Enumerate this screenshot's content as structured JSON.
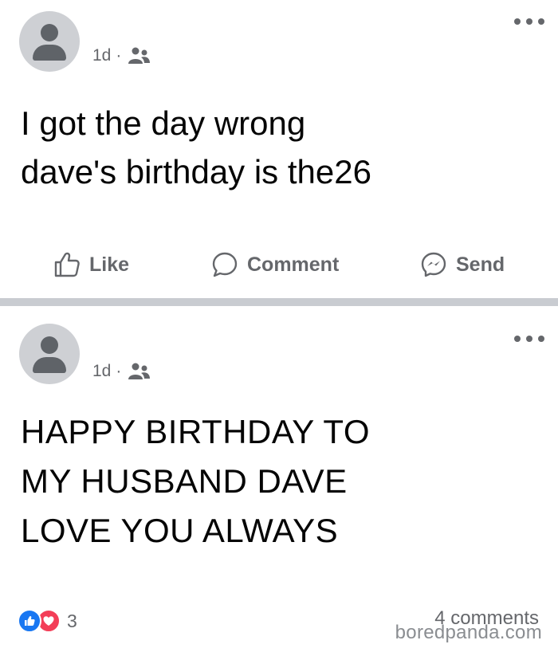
{
  "posts": [
    {
      "time": "1d",
      "separator": "·",
      "audience_icon": "friends-icon",
      "text_lines": [
        "I got the day wrong",
        "dave's birthday is the26"
      ],
      "actions": {
        "like": "Like",
        "comment": "Comment",
        "send": "Send"
      }
    },
    {
      "time": "1d",
      "separator": "·",
      "audience_icon": "friends-icon",
      "text_lines": [
        "HAPPY BIRTHDAY TO",
        "MY HUSBAND DAVE",
        "LOVE YOU ALWAYS"
      ],
      "reactions": {
        "types": [
          "like-reaction-icon",
          "love-reaction-icon"
        ],
        "count": "3"
      },
      "comments": "4 comments"
    }
  ],
  "watermark": "boredpanda.com",
  "colors": {
    "facebook_blue": "#1877f2",
    "love_red": "#f33e58",
    "secondary_text": "#65676b",
    "divider": "#c9ccd1",
    "avatar_bg": "#ced0d4"
  }
}
